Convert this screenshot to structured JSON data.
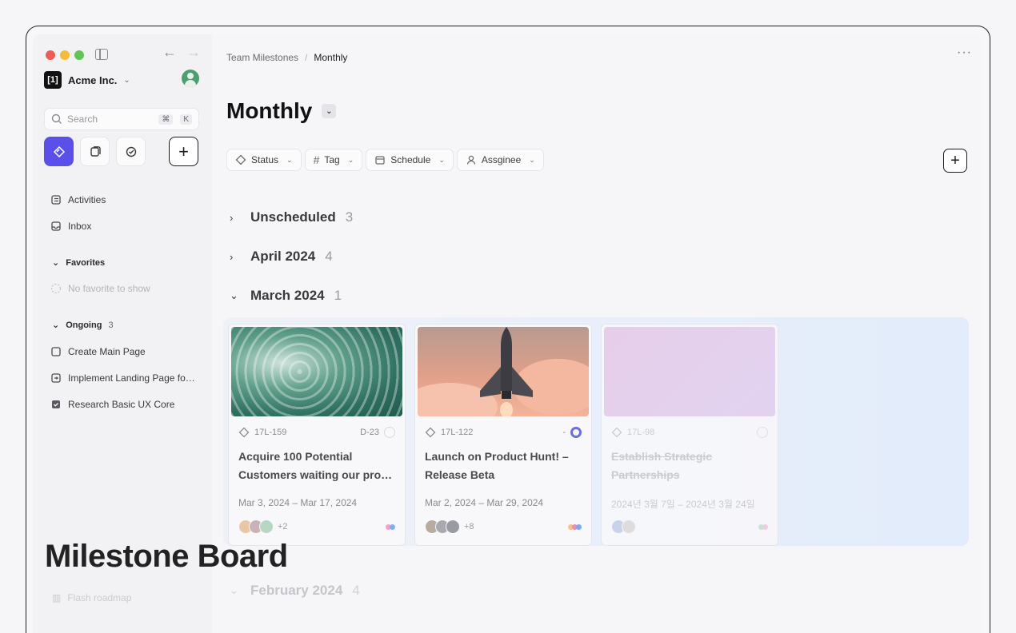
{
  "window": {
    "traffic_colors": [
      "#ee5d55",
      "#f4bc3b",
      "#5fc553"
    ]
  },
  "workspace": {
    "logo_text": "[1]",
    "name": "Acme Inc."
  },
  "search": {
    "placeholder": "Search",
    "shortcut_mod": "⌘",
    "shortcut_key": "K"
  },
  "sidebar": {
    "items": [
      {
        "label": "Activities",
        "icon": "activities-icon"
      },
      {
        "label": "Inbox",
        "icon": "inbox-icon"
      }
    ],
    "favorites": {
      "label": "Favorites",
      "empty": "No favorite to show"
    },
    "ongoing": {
      "label": "Ongoing",
      "count": "3",
      "items": [
        "Create Main Page",
        "Implement Landing Page fo…",
        "Research Basic UX Core"
      ]
    },
    "faint_item": "Flash roadmap"
  },
  "breadcrumb": {
    "parent": "Team Milestones",
    "separator": "/",
    "current": "Monthly"
  },
  "page": {
    "title": "Monthly"
  },
  "filters": [
    "Status",
    "Tag",
    "Schedule",
    "Assginee"
  ],
  "groups": [
    {
      "label": "Unscheduled",
      "count": "3"
    },
    {
      "label": "April 2024",
      "count": "4"
    },
    {
      "label": "March 2024",
      "count": "1"
    },
    {
      "label": "February 2024",
      "count": "4"
    }
  ],
  "cards": [
    {
      "id": "17L-159",
      "due": "D-23",
      "title": "Acquire 100 Potential Customers waiting our pro…",
      "dates": "Mar 3, 2024  –  Mar 17, 2024",
      "more_people": "+2",
      "tag_colors": [
        "#f0a0d8",
        "#7fb0f0"
      ]
    },
    {
      "id": "17L-122",
      "due": "-",
      "title": "Launch on Product Hunt! – Release Beta",
      "dates": "Mar 2, 2024  –  Mar 29, 2024",
      "more_people": "+8",
      "tag_colors": [
        "#f6c28a",
        "#f08ab0",
        "#7fa8f0"
      ]
    },
    {
      "id": "17L-98",
      "due": "",
      "title": "Establish Strategic Partnerships",
      "dates": "2024년 3월 7일  –  2024년 3월 24일",
      "more_people": "",
      "tag_colors": [
        "#9fd8b8",
        "#f0a8c8"
      ]
    }
  ],
  "overlay": {
    "title": "Milestone Board"
  }
}
